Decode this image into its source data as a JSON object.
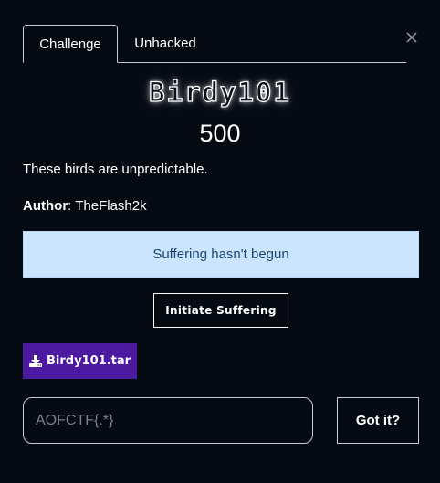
{
  "tabs": {
    "challenge": "Challenge",
    "unhacked": "Unhacked"
  },
  "challenge": {
    "name": "Birdy101",
    "points": "500",
    "description": "These birds are unpredictable.",
    "author_label": "Author",
    "author_name": "TheFlash2k"
  },
  "status": {
    "message": "Suffering hasn't begun"
  },
  "actions": {
    "initiate_label": "Initiate Suffering",
    "file_label": "Birdy101.tar"
  },
  "submit": {
    "placeholder": "AOFCTF{.*}",
    "button_label": "Got it?"
  },
  "colors": {
    "background": "#060a12",
    "alert_bg": "#cce5ff",
    "alert_text": "#1c4670",
    "file_button": "#4c1aa0"
  },
  "icons": {
    "close": "close-icon",
    "download": "download-icon"
  }
}
